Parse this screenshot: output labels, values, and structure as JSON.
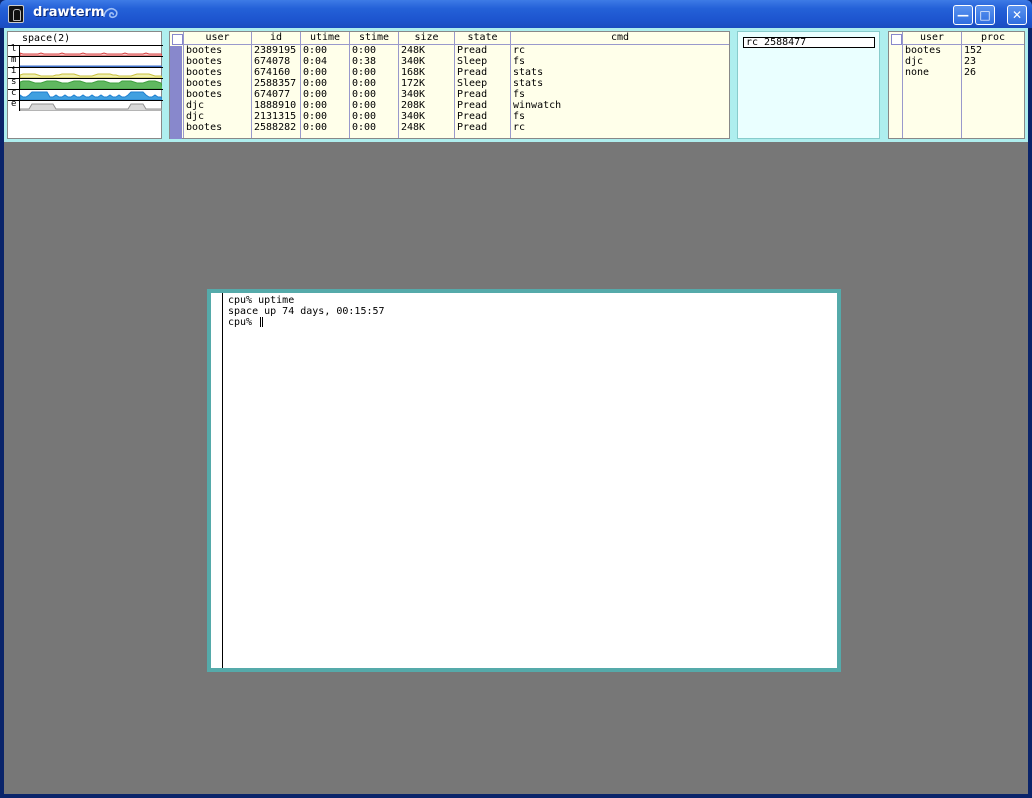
{
  "window": {
    "title": "drawterm",
    "buttons": [
      "minimize",
      "maximize",
      "close"
    ]
  },
  "stats": {
    "title": "space(2)",
    "rows": [
      {
        "label": "l",
        "color": "#d84040",
        "fill": "#f3c8c8"
      },
      {
        "label": "m",
        "color": "#4070c8",
        "fill": "#ffffff"
      },
      {
        "label": "i",
        "color": "#c8c040",
        "fill": "#f0f0b0"
      },
      {
        "label": "s",
        "color": "#40a040",
        "fill": "#60b860"
      },
      {
        "label": "c",
        "color": "#2080d0",
        "fill": "#40a0e0"
      },
      {
        "label": "e",
        "color": "#909090",
        "fill": "#d8d8d8"
      }
    ]
  },
  "processes": {
    "columns": [
      "user",
      "id",
      "utime",
      "stime",
      "size",
      "state",
      "cmd"
    ],
    "rows": [
      [
        "bootes",
        "2389195",
        "0:00",
        "0:00",
        "248K",
        "Pread",
        "rc"
      ],
      [
        "bootes",
        "674078",
        "0:04",
        "0:38",
        "340K",
        "Sleep",
        "fs"
      ],
      [
        "bootes",
        "674160",
        "0:00",
        "0:00",
        "168K",
        "Pread",
        "stats"
      ],
      [
        "bootes",
        "2588357",
        "0:00",
        "0:00",
        "172K",
        "Sleep",
        "stats"
      ],
      [
        "bootes",
        "674077",
        "0:00",
        "0:00",
        "340K",
        "Pread",
        "fs"
      ],
      [
        "djc",
        "1888910",
        "0:00",
        "0:00",
        "208K",
        "Pread",
        "winwatch"
      ],
      [
        "djc",
        "2131315",
        "0:00",
        "0:00",
        "340K",
        "Pread",
        "fs"
      ],
      [
        "bootes",
        "2588282",
        "0:00",
        "0:00",
        "248K",
        "Pread",
        "rc"
      ]
    ]
  },
  "rc": {
    "value": "rc 2588477"
  },
  "users": {
    "columns": [
      "user",
      "proc"
    ],
    "rows": [
      [
        "bootes",
        "152"
      ],
      [
        "djc",
        "23"
      ],
      [
        "none",
        "26"
      ]
    ]
  },
  "terminal": {
    "lines": [
      "cpu% uptime",
      "space up 74 days, 00:15:57",
      "cpu% "
    ]
  },
  "colors": {
    "desktop": "#777777",
    "strip": "#aeeeee",
    "table_bg": "#ffffea",
    "window_border": "#55aaaa",
    "scrollbar": "#8888cc"
  }
}
